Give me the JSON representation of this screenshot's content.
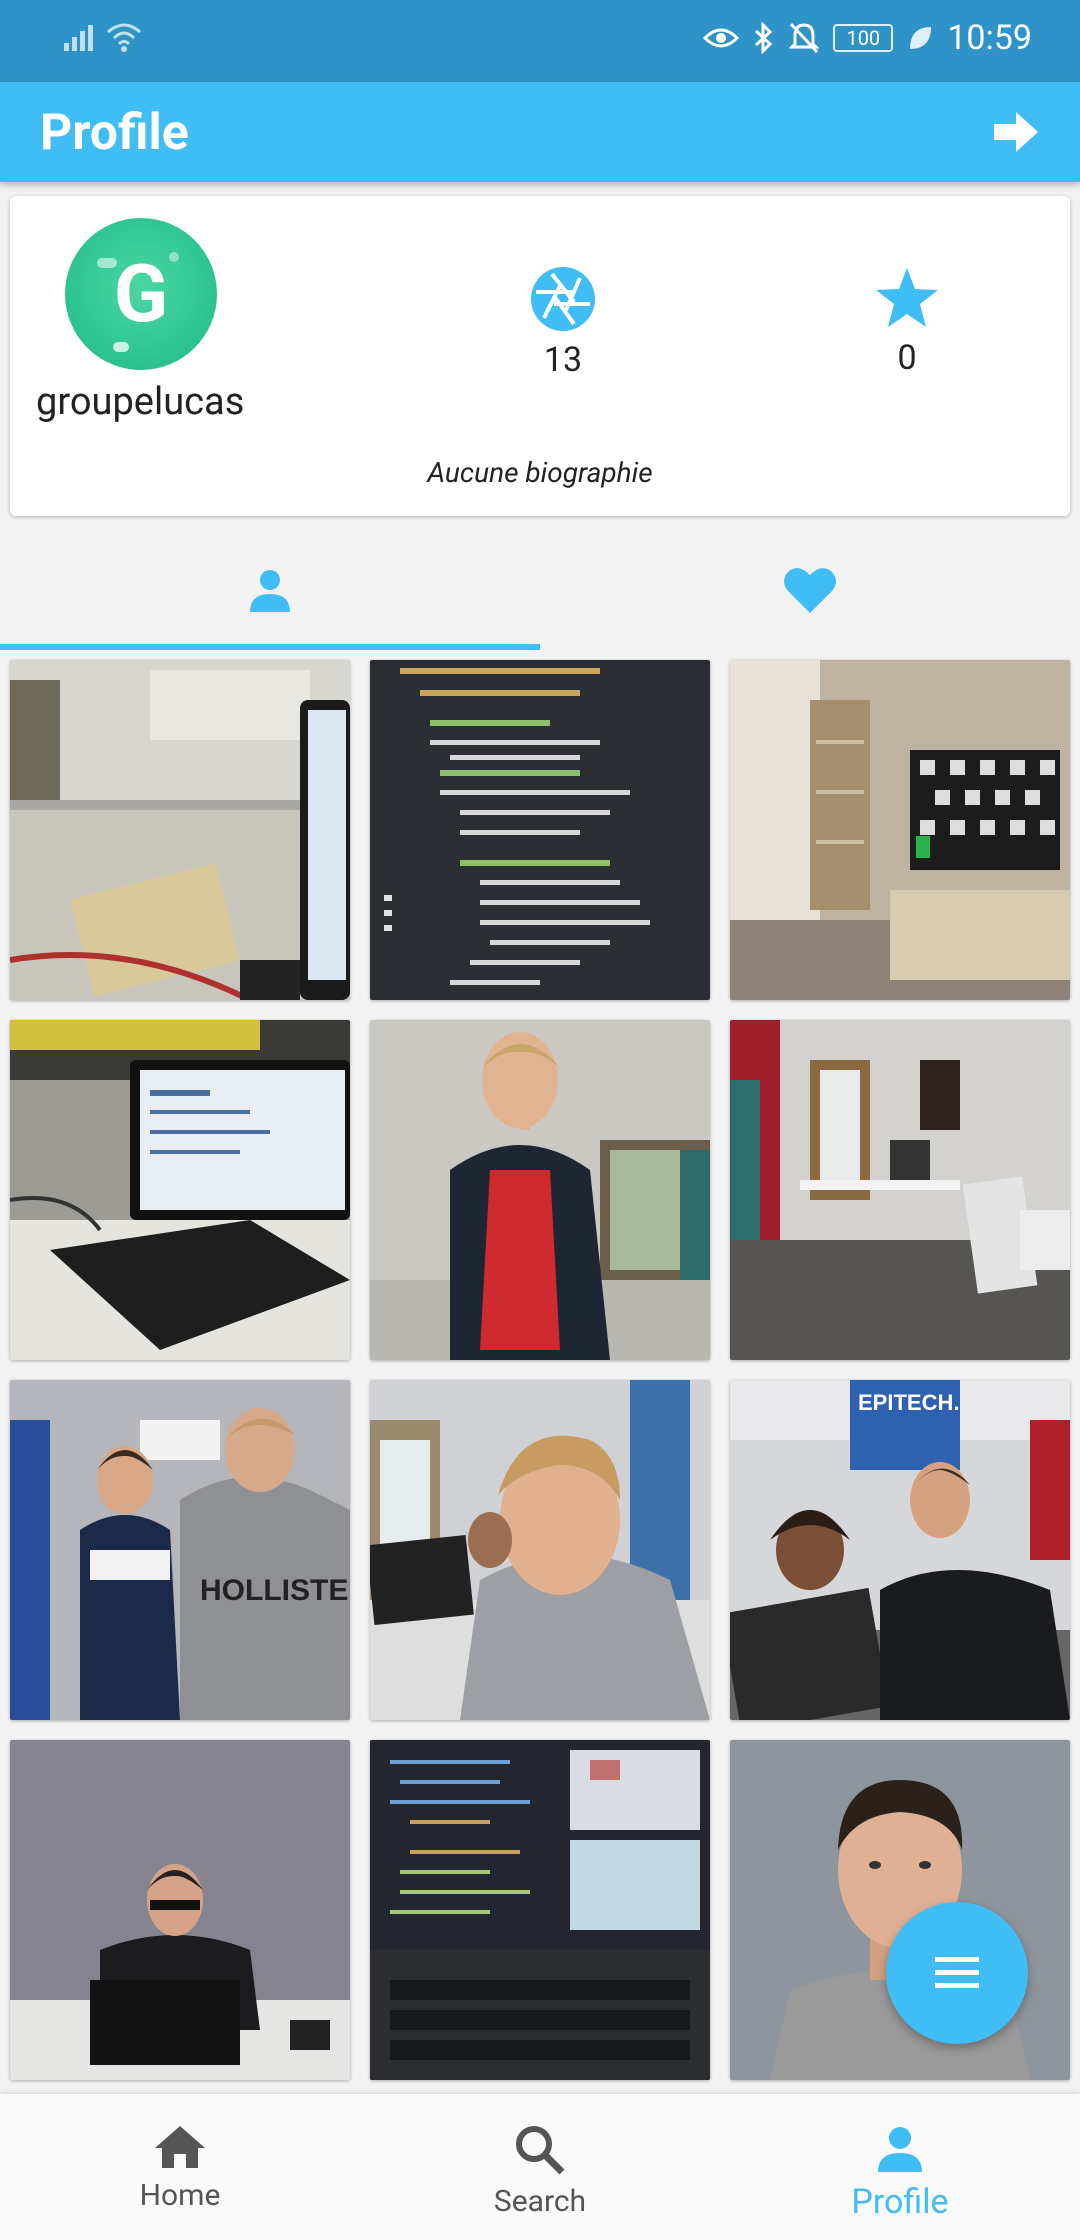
{
  "status_bar": {
    "time": "10:59",
    "battery": "100"
  },
  "header": {
    "title": "Profile",
    "logout_icon": "logout-arrow-icon"
  },
  "profile": {
    "avatar_letter": "G",
    "username": "groupelucas",
    "photos_count": "13",
    "favorites_count": "0",
    "bio": "Aucune biographie"
  },
  "tabs": [
    {
      "icon": "person-icon",
      "active": true
    },
    {
      "icon": "heart-icon",
      "active": false
    }
  ],
  "bottom_nav": {
    "items": [
      {
        "label": "Home",
        "icon": "home-icon"
      },
      {
        "label": "Search",
        "icon": "search-icon"
      },
      {
        "label": "Profile",
        "icon": "person-icon",
        "active": true
      }
    ]
  },
  "colors": {
    "primary": "#41bdf5",
    "status_bar": "#2f93c7",
    "avatar": "#2fc693"
  }
}
